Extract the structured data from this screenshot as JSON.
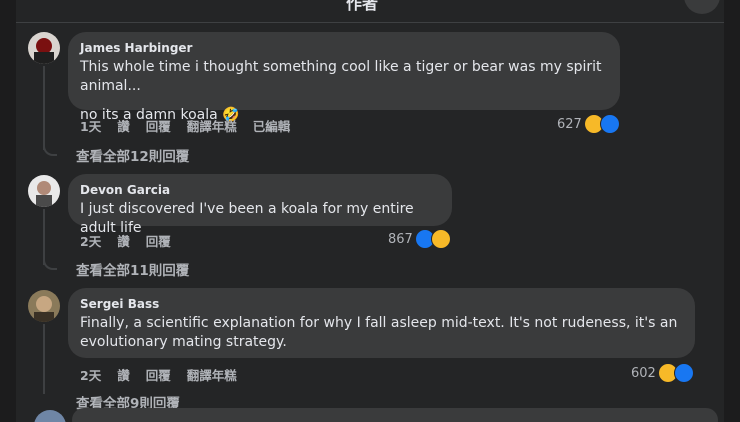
{
  "header": {
    "title": "作者"
  },
  "comments": [
    {
      "author": "James Harbinger",
      "text1": "This whole time i thought something cool like a tiger or bear was my spirit animal...",
      "text2": "no its a damn koala 🤣",
      "time": "1天",
      "like": "讚",
      "reply": "回覆",
      "translate": "翻譯年糕",
      "edited": "已編輯",
      "reactions_count": "627",
      "view_replies": "查看全部12則回覆"
    },
    {
      "author": "Devon Garcia",
      "text1": "I just discovered I've been a koala for my entire adult life",
      "time": "2天",
      "like": "讚",
      "reply": "回覆",
      "reactions_count": "867",
      "view_replies": "查看全部11則回覆"
    },
    {
      "author": "Sergei Bass",
      "text1": "Finally, a scientific explanation for why I fall asleep mid-text. It's not rudeness, it's an",
      "text2": "evolutionary mating strategy.",
      "time": "2天",
      "like": "讚",
      "reply": "回覆",
      "translate": "翻譯年糕",
      "reactions_count": "602",
      "view_replies": "查看全部9則回覆"
    }
  ],
  "colors": {
    "like_blue": "#1877f2",
    "haha_yellow": "#f7b928"
  }
}
